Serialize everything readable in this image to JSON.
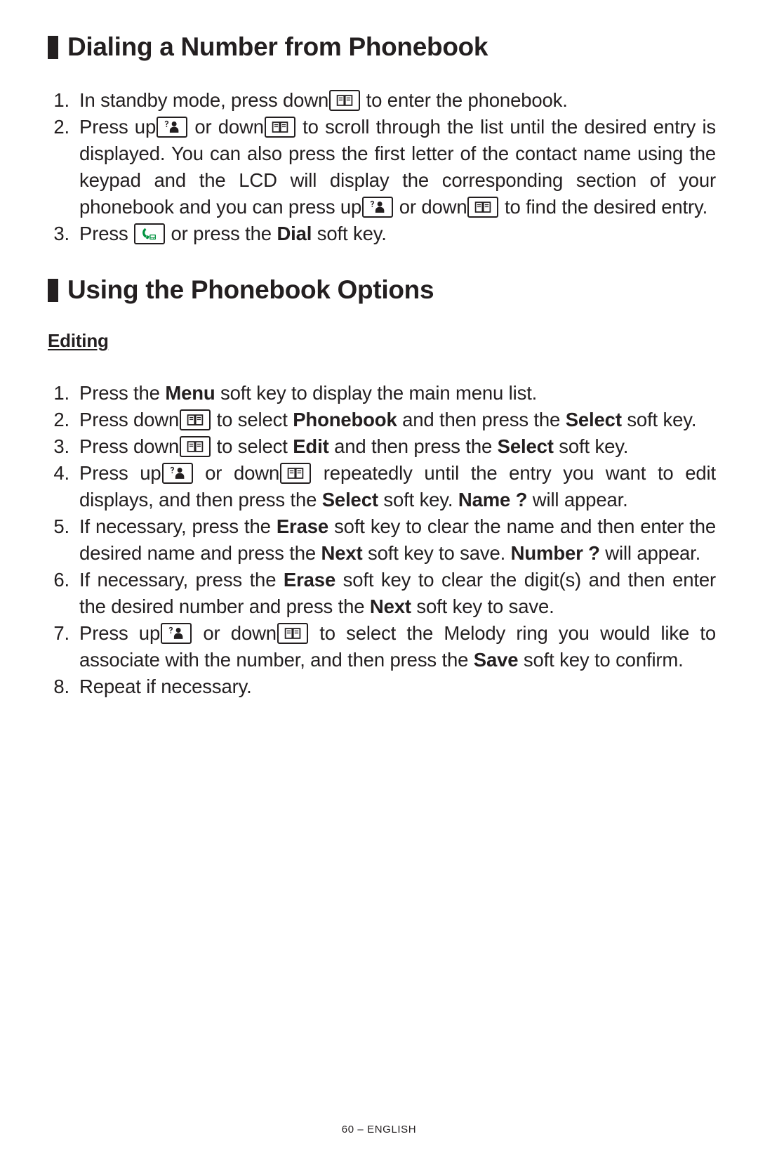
{
  "page": {
    "footer": "60 – ENGLISH"
  },
  "icons": {
    "down_key": "phonebook-book-icon",
    "up_key": "caller-id-person-icon",
    "dial_key": "green-phone-handset-icon"
  },
  "colors": {
    "text": "#231f20",
    "phone_green": "#00923f",
    "background": "#ffffff"
  },
  "section1": {
    "heading": "Dialing a Number from Phonebook",
    "steps": [
      {
        "num": "1.",
        "parts": [
          {
            "t": "text",
            "v": "In standby mode, press down"
          },
          {
            "t": "icon",
            "v": "down_key"
          },
          {
            "t": "text",
            "v": " to enter the phonebook."
          }
        ]
      },
      {
        "num": "2.",
        "parts": [
          {
            "t": "text",
            "v": "Press up"
          },
          {
            "t": "icon",
            "v": "up_key"
          },
          {
            "t": "text",
            "v": " or down"
          },
          {
            "t": "icon",
            "v": "down_key"
          },
          {
            "t": "text",
            "v": " to scroll through the list until the desired entry is displayed.  You can also press the first letter of the contact name using the keypad and the LCD will display the corresponding section of your phonebook and you can press up"
          },
          {
            "t": "icon",
            "v": "up_key"
          },
          {
            "t": "text",
            "v": " or down"
          },
          {
            "t": "icon",
            "v": "down_key"
          },
          {
            "t": "text",
            "v": " to find the desired entry."
          }
        ]
      },
      {
        "num": "3.",
        "parts": [
          {
            "t": "text",
            "v": "Press "
          },
          {
            "t": "icon",
            "v": "dial_key"
          },
          {
            "t": "text",
            "v": " or press the "
          },
          {
            "t": "bold",
            "v": "Dial"
          },
          {
            "t": "text",
            "v": " soft key."
          }
        ]
      }
    ]
  },
  "section2": {
    "heading": "Using the Phonebook Options",
    "subheading": "Editing",
    "steps": [
      {
        "num": "1.",
        "parts": [
          {
            "t": "text",
            "v": "Press the "
          },
          {
            "t": "bold",
            "v": "Menu"
          },
          {
            "t": "text",
            "v": " soft key to display the main menu list."
          }
        ]
      },
      {
        "num": "2.",
        "parts": [
          {
            "t": "text",
            "v": "Press down"
          },
          {
            "t": "icon",
            "v": "down_key"
          },
          {
            "t": "text",
            "v": " to select "
          },
          {
            "t": "bold",
            "v": "Phonebook"
          },
          {
            "t": "text",
            "v": " and then press the "
          },
          {
            "t": "bold",
            "v": "Select"
          },
          {
            "t": "text",
            "v": " soft key."
          }
        ]
      },
      {
        "num": "3.",
        "parts": [
          {
            "t": "text",
            "v": "Press down"
          },
          {
            "t": "icon",
            "v": "down_key"
          },
          {
            "t": "text",
            "v": " to select "
          },
          {
            "t": "bold",
            "v": "Edit"
          },
          {
            "t": "text",
            "v": " and then press the "
          },
          {
            "t": "bold",
            "v": "Select"
          },
          {
            "t": "text",
            "v": " soft key."
          }
        ]
      },
      {
        "num": "4.",
        "parts": [
          {
            "t": "text",
            "v": "Press up"
          },
          {
            "t": "icon",
            "v": "up_key"
          },
          {
            "t": "text",
            "v": " or down"
          },
          {
            "t": "icon",
            "v": "down_key"
          },
          {
            "t": "text",
            "v": " repeatedly until the entry you want to edit displays, and then press the "
          },
          {
            "t": "bold",
            "v": "Select"
          },
          {
            "t": "text",
            "v": " soft key.  "
          },
          {
            "t": "bold",
            "v": "Name ?"
          },
          {
            "t": "text",
            "v": " will appear."
          }
        ]
      },
      {
        "num": "5.",
        "parts": [
          {
            "t": "text",
            "v": "If necessary, press the "
          },
          {
            "t": "bold",
            "v": "Erase"
          },
          {
            "t": "text",
            "v": " soft key to clear the name and then enter the desired name and press the "
          },
          {
            "t": "bold",
            "v": "Next"
          },
          {
            "t": "text",
            "v": " soft key to save.  "
          },
          {
            "t": "bold",
            "v": "Number ?"
          },
          {
            "t": "text",
            "v": " will appear."
          }
        ]
      },
      {
        "num": "6.",
        "parts": [
          {
            "t": "text",
            "v": "If necessary, press the "
          },
          {
            "t": "bold",
            "v": "Erase"
          },
          {
            "t": "text",
            "v": " soft key to clear the digit(s) and then enter the desired number and press the "
          },
          {
            "t": "bold",
            "v": "Next"
          },
          {
            "t": "text",
            "v": " soft key to save."
          }
        ]
      },
      {
        "num": "7.",
        "parts": [
          {
            "t": "text",
            "v": "Press up"
          },
          {
            "t": "icon",
            "v": "up_key"
          },
          {
            "t": "text",
            "v": " or down"
          },
          {
            "t": "icon",
            "v": "down_key"
          },
          {
            "t": "text",
            "v": " to select the Melody ring you would like to associate with the number, and then press the "
          },
          {
            "t": "bold",
            "v": "Save"
          },
          {
            "t": "text",
            "v": " soft key to confirm."
          }
        ]
      },
      {
        "num": "8.",
        "parts": [
          {
            "t": "text",
            "v": "Repeat if necessary."
          }
        ]
      }
    ]
  }
}
